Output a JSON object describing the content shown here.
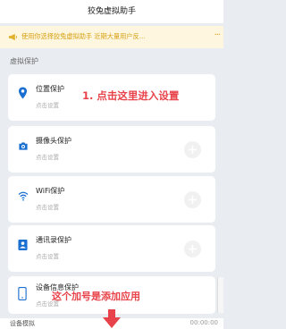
{
  "header": {
    "title": "狡兔虚拟助手"
  },
  "notice": {
    "text": "使用你选择狡兔虚拟助手 近期大量用户反…",
    "more": "···",
    "color": "#d6a216"
  },
  "section": {
    "title": "虚拟保护"
  },
  "items": [
    {
      "label": "位置保护",
      "sub": "点击设置",
      "icon": "location-pin-icon"
    },
    {
      "label": "摄像头保护",
      "sub": "点击设置",
      "icon": "camera-icon"
    },
    {
      "label": "WiFi保护",
      "sub": "点击设置",
      "icon": "wifi-icon"
    },
    {
      "label": "通讯录保护",
      "sub": "点击设置",
      "icon": "contacts-icon"
    },
    {
      "label": "设备信息保护",
      "sub": "点击设置",
      "icon": "phone-icon"
    }
  ],
  "annotations": {
    "step1": "1. 点击这里进入设置",
    "plus_hint": "这个加号是添加应用",
    "color": "#e8434a"
  },
  "bottom": {
    "left": "设备模拟",
    "right": "00:00:00"
  },
  "accent": "#1a6fd1"
}
